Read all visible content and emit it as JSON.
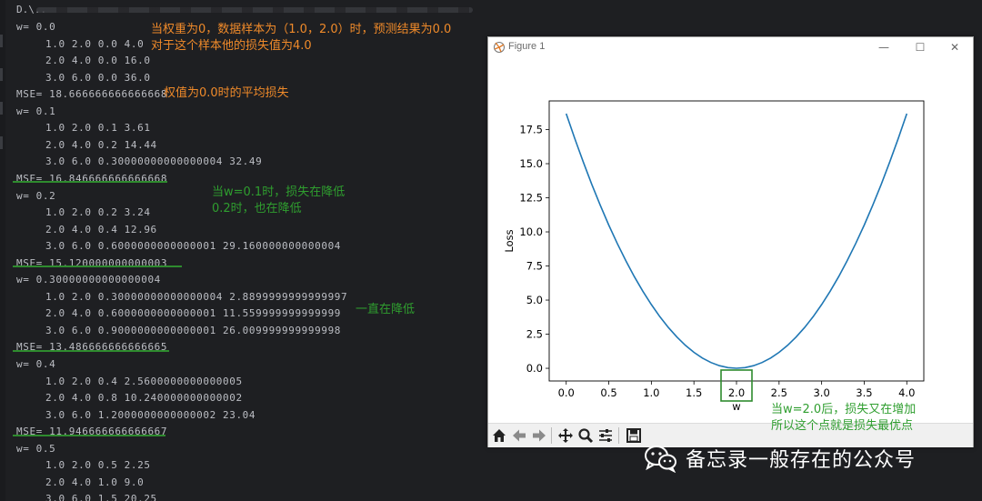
{
  "console": {
    "first_line": "D.\\..",
    "lines": [
      {
        "text": "w= 0.0",
        "indent": false
      },
      {
        "text": "1.0 2.0 0.0 4.0",
        "indent": true
      },
      {
        "text": "2.0 4.0 0.0 16.0",
        "indent": true
      },
      {
        "text": "3.0 6.0 0.0 36.0",
        "indent": true
      },
      {
        "text": "MSE= 18.666666666666668",
        "indent": false
      },
      {
        "text": "w= 0.1",
        "indent": false
      },
      {
        "text": "1.0 2.0 0.1 3.61",
        "indent": true
      },
      {
        "text": "2.0 4.0 0.2 14.44",
        "indent": true
      },
      {
        "text": "3.0 6.0 0.30000000000000004 32.49",
        "indent": true
      },
      {
        "text": "MSE= 16.846666666666668",
        "indent": false
      },
      {
        "text": "w= 0.2",
        "indent": false
      },
      {
        "text": "1.0 2.0 0.2 3.24",
        "indent": true
      },
      {
        "text": "2.0 4.0 0.4 12.96",
        "indent": true
      },
      {
        "text": "3.0 6.0 0.6000000000000001 29.160000000000004",
        "indent": true
      },
      {
        "text": "MSE= 15.120000000000003",
        "indent": false
      },
      {
        "text": "w= 0.30000000000000004",
        "indent": false
      },
      {
        "text": "1.0 2.0 0.30000000000000004 2.8899999999999997",
        "indent": true
      },
      {
        "text": "2.0 4.0 0.6000000000000001 11.559999999999999",
        "indent": true
      },
      {
        "text": "3.0 6.0 0.9000000000000001 26.009999999999998",
        "indent": true
      },
      {
        "text": "MSE= 13.486666666666665",
        "indent": false
      },
      {
        "text": "w= 0.4",
        "indent": false
      },
      {
        "text": "1.0 2.0 0.4 2.5600000000000005",
        "indent": true
      },
      {
        "text": "2.0 4.0 0.8 10.240000000000002",
        "indent": true
      },
      {
        "text": "3.0 6.0 1.2000000000000002 23.04",
        "indent": true
      },
      {
        "text": "MSE= 11.946666666666667",
        "indent": false
      },
      {
        "text": "w= 0.5",
        "indent": false
      },
      {
        "text": "1.0 2.0 0.5 2.25",
        "indent": true
      },
      {
        "text": "2.0 4.0 1.0 9.0",
        "indent": true
      },
      {
        "text": "3.0 6.0 1.5 20.25",
        "indent": true
      }
    ]
  },
  "annotations": {
    "orange_1": "当权重为0，数据样本为（1.0，2.0）时，预测结果为0.0\n对于这个样本他的损失值为4.0",
    "orange_2": "权值为0.0时的平均损失",
    "green_1": "当w=0.1时，损失在降低\n0.2时，也在降低",
    "green_2": "一直在降低",
    "green_3": "当w=2.0后，损失又在增加\n所以这个点就是损失最优点"
  },
  "figure": {
    "title": "Figure 1",
    "minimize_label": "—",
    "maximize_label": "☐",
    "close_label": "✕",
    "toolbar_icons": [
      "home-icon",
      "back-arrow-icon",
      "forward-arrow-icon",
      "pan-icon",
      "zoom-icon",
      "configure-subplots-icon",
      "save-icon"
    ]
  },
  "chart_data": {
    "type": "line",
    "xlabel": "w",
    "ylabel": "Loss",
    "xlim": [
      -0.2,
      4.2
    ],
    "ylim": [
      -0.93,
      19.6
    ],
    "xticks": [
      "0.0",
      "0.5",
      "1.0",
      "1.5",
      "2.0",
      "2.5",
      "3.0",
      "3.5",
      "4.0"
    ],
    "yticks": [
      "0.0",
      "2.5",
      "5.0",
      "7.5",
      "10.0",
      "12.5",
      "15.0",
      "17.5"
    ],
    "series": [
      {
        "color": "#1f77b4",
        "formula": "MSE(w) = (14/3) * (w - 2)^2 over samples (1,2),(2,4),(3,6)",
        "x": [
          0.0,
          0.1,
          0.2,
          0.3,
          0.4,
          0.5,
          0.6,
          0.7,
          0.8,
          0.9,
          1.0,
          1.1,
          1.2,
          1.3,
          1.4,
          1.5,
          1.6,
          1.7,
          1.8,
          1.9,
          2.0,
          2.1,
          2.2,
          2.3,
          2.4,
          2.5,
          2.6,
          2.7,
          2.8,
          2.9,
          3.0,
          3.1,
          3.2,
          3.3,
          3.4,
          3.5,
          3.6,
          3.7,
          3.8,
          3.9,
          4.0
        ],
        "y": [
          18.667,
          16.847,
          15.12,
          13.487,
          11.947,
          10.5,
          9.147,
          7.887,
          6.72,
          5.647,
          4.667,
          3.78,
          2.987,
          2.287,
          1.68,
          1.167,
          0.747,
          0.42,
          0.187,
          0.047,
          0.0,
          0.047,
          0.187,
          0.42,
          0.747,
          1.167,
          1.68,
          2.287,
          2.987,
          3.78,
          4.667,
          5.647,
          6.72,
          7.887,
          9.147,
          10.5,
          11.947,
          13.487,
          15.12,
          16.847,
          18.667
        ]
      }
    ],
    "highlight_box_x": 2.0,
    "grid": false
  },
  "watermark": {
    "text": "备忘录一般存在的公众号"
  }
}
